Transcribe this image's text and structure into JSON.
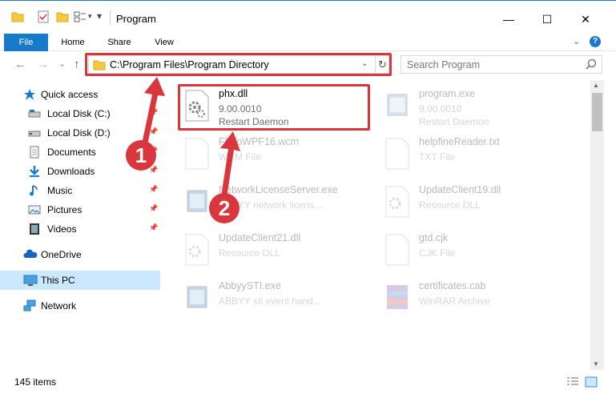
{
  "window": {
    "title": "Program",
    "minimize_glyph": "—",
    "maximize_glyph": "☐",
    "close_glyph": "✕"
  },
  "ribbon": {
    "tabs": [
      "File",
      "Home",
      "Share",
      "View"
    ],
    "accent_color": "#1979ca",
    "help_glyph": "?"
  },
  "nav": {
    "back_glyph": "←",
    "forward_glyph": "→",
    "recent_glyph": "⌄",
    "up_glyph": "↑",
    "address_path": "C:\\Program Files\\Program Directory",
    "search_placeholder": "Search Program"
  },
  "sidebar": {
    "items": [
      {
        "label": "Quick access",
        "icon": "star-icon",
        "pinned": false
      },
      {
        "label": "Local Disk (C:)",
        "icon": "drive-icon",
        "pinned": true
      },
      {
        "label": "Local Disk (D:)",
        "icon": "drive-icon",
        "pinned": true
      },
      {
        "label": "Documents",
        "icon": "documents-icon",
        "pinned": true
      },
      {
        "label": "Downloads",
        "icon": "download-icon",
        "pinned": true
      },
      {
        "label": "Music",
        "icon": "music-icon",
        "pinned": true
      },
      {
        "label": "Pictures",
        "icon": "pictures-icon",
        "pinned": true
      },
      {
        "label": "Videos",
        "icon": "videos-icon",
        "pinned": true
      },
      {
        "label": "OneDrive",
        "icon": "cloud-icon",
        "pinned": false
      },
      {
        "label": "This PC",
        "icon": "monitor-icon",
        "pinned": false,
        "selected": true
      },
      {
        "label": "Network",
        "icon": "network-icon",
        "pinned": false
      }
    ]
  },
  "files": [
    {
      "name": "phx.dll",
      "line2": "9.00.0010",
      "line3": "Restart Daemon",
      "icon": "dll-gear-icon",
      "highlighted": true
    },
    {
      "name": "program.exe",
      "line2": "9.00.0010",
      "line3": "Restart Daemon",
      "icon": "exe-icon"
    },
    {
      "name": "FBToWPF16.wcm",
      "line2": "WCM File",
      "line3": "",
      "icon": "blank-file-icon"
    },
    {
      "name": "helpfineReader.txt",
      "line2": "TXT File",
      "line3": "",
      "icon": "blank-file-icon"
    },
    {
      "name": "NetworkLicenseServer.exe",
      "line2": "ABBYY network licens...",
      "line3": "",
      "icon": "exe-icon"
    },
    {
      "name": "UpdateClient19.dll",
      "line2": "Resource DLL",
      "line3": "",
      "icon": "dll-gear-icon"
    },
    {
      "name": "UpdateClient21.dll",
      "line2": "Resource DLL",
      "line3": "",
      "icon": "dll-gear-icon"
    },
    {
      "name": "gtd.cjk",
      "line2": "CJK File",
      "line3": "",
      "icon": "blank-file-icon"
    },
    {
      "name": "AbbyySTI.exe",
      "line2": "ABBYY sti event hand...",
      "line3": "",
      "icon": "exe-icon"
    },
    {
      "name": "certificates.cab",
      "line2": "WinRAR Archive",
      "line3": "",
      "icon": "archive-icon"
    }
  ],
  "status": {
    "item_count": "145 items"
  },
  "annotations": {
    "badge1": "1",
    "badge2": "2",
    "color": "#d9363e"
  }
}
